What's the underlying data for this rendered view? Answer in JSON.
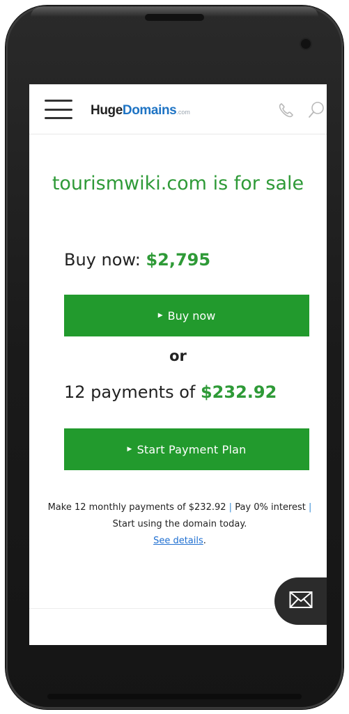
{
  "header": {
    "logo": {
      "huge": "Huge",
      "domains": "Domains",
      "tld": ".com"
    }
  },
  "listing": {
    "headline": "tourismwiki.com is for sale",
    "buy_now_prefix": "Buy now:",
    "buy_now_price": "$2,795",
    "buy_button_label": "Buy now",
    "or_label": "or",
    "payments_prefix": "12 payments of",
    "payments_price": "$232.92",
    "plan_button_label": "Start Payment Plan"
  },
  "details": {
    "part1": "Make 12 monthly payments of $232.92",
    "separator": "|",
    "part2": "Pay 0% interest",
    "part3": "Start using the domain today.",
    "link": "See details",
    "trailing": "."
  },
  "icons": {
    "menu": "hamburger-menu-icon",
    "phone": "phone-icon",
    "search": "search-icon",
    "mail": "envelope-icon"
  },
  "colors": {
    "green_text": "#2e9a37",
    "green_button": "#229a2d",
    "logo_blue": "#1f74c4",
    "link_blue": "#1f6fd1"
  }
}
